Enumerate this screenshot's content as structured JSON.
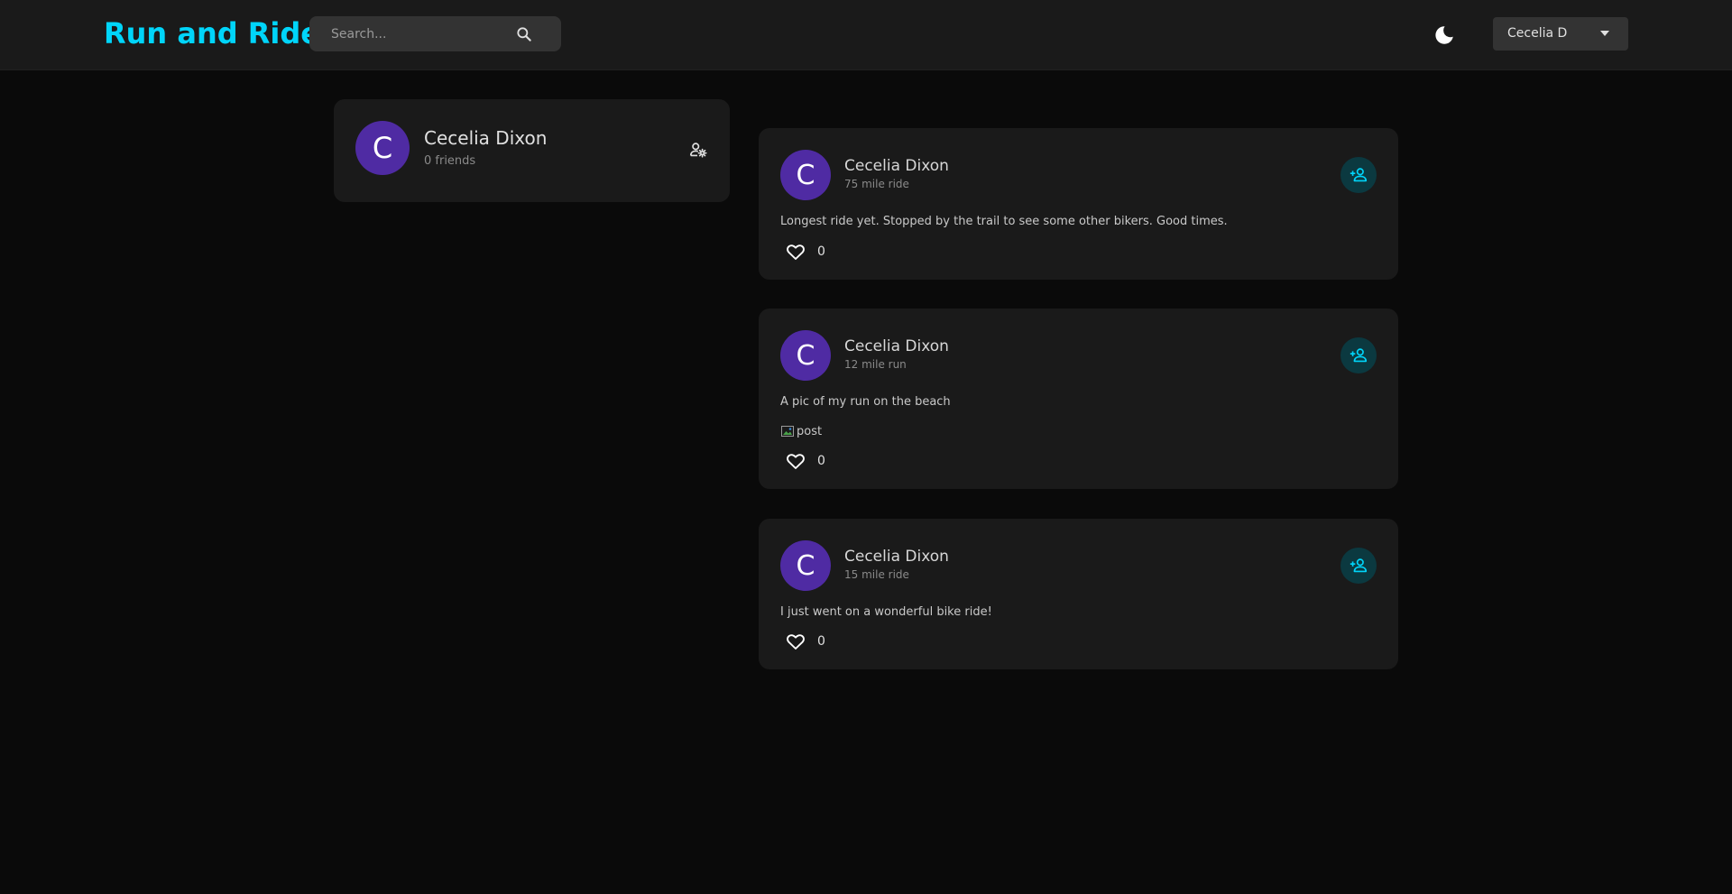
{
  "app": {
    "title": "Run and Ride",
    "accent": "#00d5fa"
  },
  "header": {
    "search": {
      "placeholder": "Search...",
      "value": ""
    },
    "user_select": {
      "selected": "Cecelia D"
    }
  },
  "profile": {
    "avatar_initial": "C",
    "name": "Cecelia Dixon",
    "friends": "0 friends"
  },
  "posts": [
    {
      "avatar_initial": "C",
      "name": "Cecelia Dixon",
      "location": "75 mile ride",
      "description": "Longest ride yet. Stopped by the trail to see some other bikers. Good times.",
      "likes": "0"
    },
    {
      "avatar_initial": "C",
      "name": "Cecelia Dixon",
      "location": "12 mile run",
      "description": "A pic of my run on the beach",
      "image_alt": "post",
      "likes": "0"
    },
    {
      "avatar_initial": "C",
      "name": "Cecelia Dixon",
      "location": "15 mile ride",
      "description": "I just went on a wonderful bike ride!",
      "likes": "0"
    }
  ],
  "colors": {
    "avatar": "#4f2ba3",
    "add_friend_bg": "#0b3940",
    "add_friend_icon": "#00d5fa"
  },
  "icons": {
    "search": "search-icon",
    "dark_mode": "moon-icon",
    "dropdown": "caret-down-icon",
    "manage": "manage-accounts-icon",
    "add_friend": "person-add-icon",
    "like": "heart-outline-icon"
  }
}
